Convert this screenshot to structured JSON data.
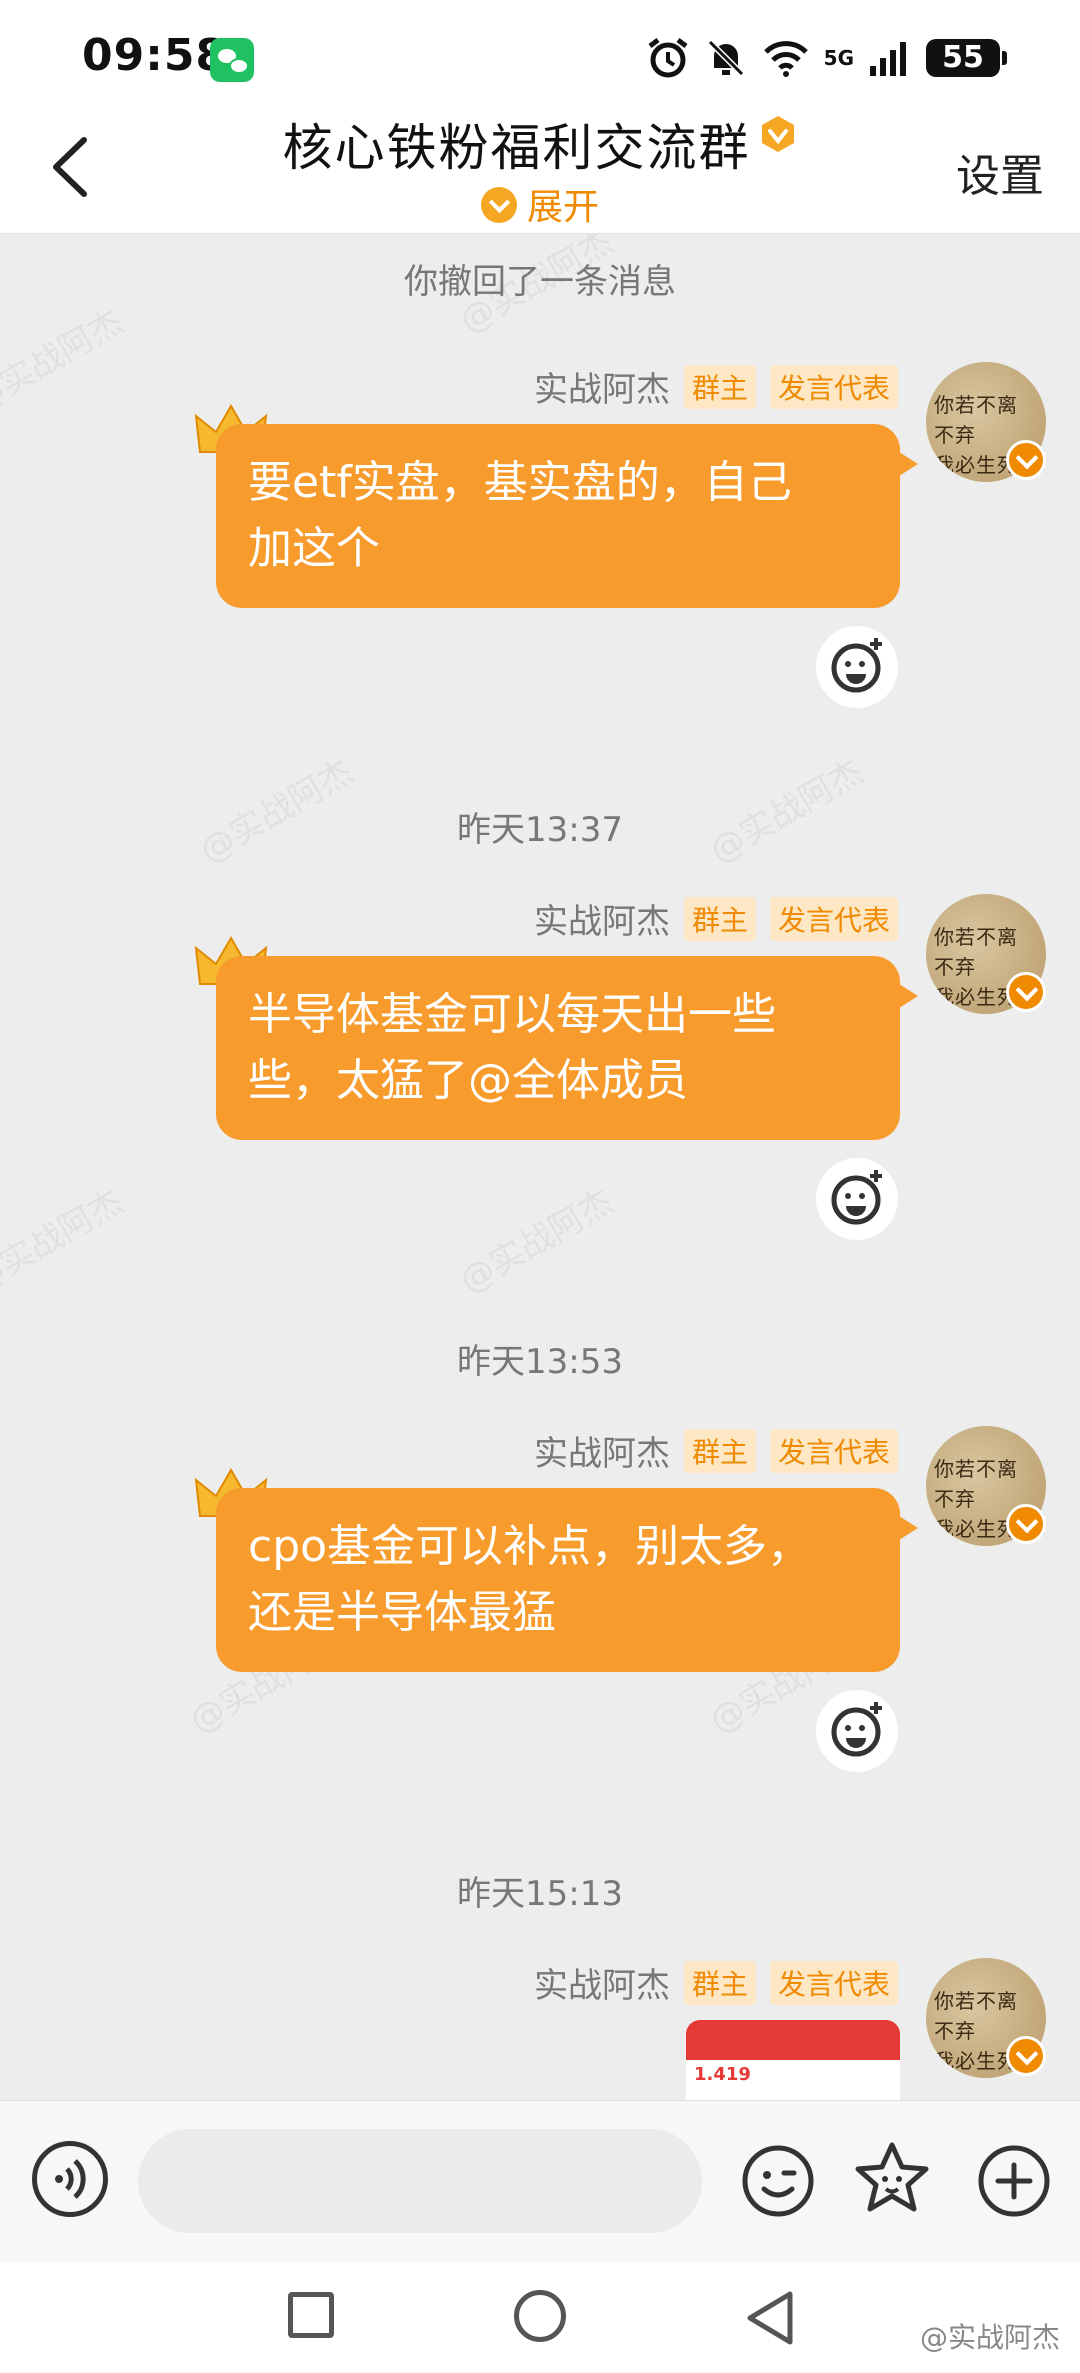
{
  "status_bar": {
    "time": "09:58",
    "network": "5G",
    "battery": "55",
    "wechat_icon": "wechat-icon",
    "icons": [
      "alarm-icon",
      "mute-bell-icon",
      "wifi-icon",
      "signal-icon",
      "battery-icon"
    ]
  },
  "header": {
    "title": "核心铁粉福利交流群",
    "expand_label": "展开",
    "settings_label": "设置",
    "accent_color": "#f08a00"
  },
  "messages": [
    {
      "type": "system",
      "text": "你撤回了一条消息"
    },
    {
      "type": "message",
      "sender": "实战阿杰",
      "tags": [
        "群主",
        "发言代表"
      ],
      "text_lines": [
        "要etf实盘，基实盘的，自己",
        "加这个"
      ]
    },
    {
      "type": "timestamp",
      "text": "昨天13:37"
    },
    {
      "type": "message",
      "sender": "实战阿杰",
      "tags": [
        "群主",
        "发言代表"
      ],
      "text_lines": [
        "半导体基金可以每天出一些",
        "些，太猛了@全体成员"
      ]
    },
    {
      "type": "timestamp",
      "text": "昨天13:53"
    },
    {
      "type": "message",
      "sender": "实战阿杰",
      "tags": [
        "群主",
        "发言代表"
      ],
      "text_lines": [
        "cpo基金可以补点，别太多，",
        "还是半导体最猛"
      ]
    },
    {
      "type": "timestamp",
      "text": "昨天15:13"
    },
    {
      "type": "image_message",
      "sender": "实战阿杰",
      "tags": [
        "群主",
        "发言代表"
      ],
      "image_value": "1.419"
    }
  ],
  "avatar_text": [
    "你若不离不弃",
    "我必生死相依"
  ],
  "watermark": "@实战阿杰",
  "input": {
    "placeholder": ""
  },
  "weibo_mark": "@实战阿杰",
  "bubble_color": "#f89b2d"
}
